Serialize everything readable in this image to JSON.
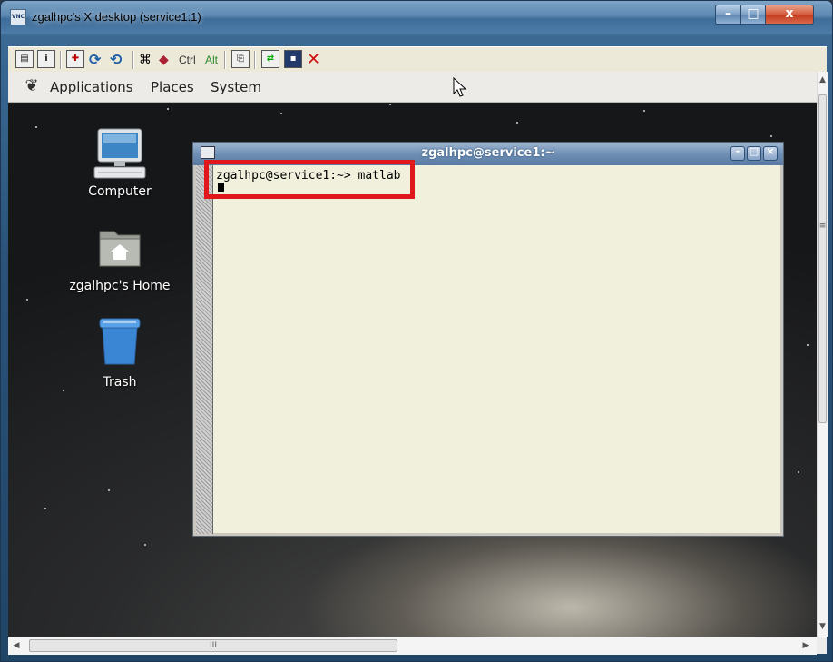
{
  "window": {
    "title": "zgalhpc's X desktop (service1:1)",
    "app_icon_text": "VNC",
    "minimize_glyph": "–",
    "maximize_glyph": "□",
    "close_glyph": "x"
  },
  "toolbar": {
    "ctrl_label": "Ctrl",
    "alt_label": "Alt",
    "icons": [
      "properties-icon",
      "info-icon",
      "fullscreen-icon",
      "refresh-icon",
      "refresh-alt-icon",
      "ctrl-alt-del-icon",
      "send-keys-icon",
      "copy-icon",
      "transfer-icon",
      "save-icon",
      "disconnect-icon"
    ]
  },
  "gnome_panel": {
    "menus": [
      "Applications",
      "Places",
      "System"
    ]
  },
  "desktop_icons": [
    {
      "label": "Computer",
      "icon": "computer-icon"
    },
    {
      "label": "zgalhpc's Home",
      "icon": "home-folder-icon"
    },
    {
      "label": "Trash",
      "icon": "trash-icon"
    }
  ],
  "terminal": {
    "title": "zgalhpc@service1:~",
    "prompt_line": "zgalhpc@service1:~> matlab"
  },
  "scrollbars": {
    "h_thumb_glyph": "III",
    "v_thumb_glyph": "≡"
  },
  "colors": {
    "highlight": "#e0181c",
    "terminal_bg": "#f0f0dc",
    "titlebar_blue": "#5c88b2"
  }
}
